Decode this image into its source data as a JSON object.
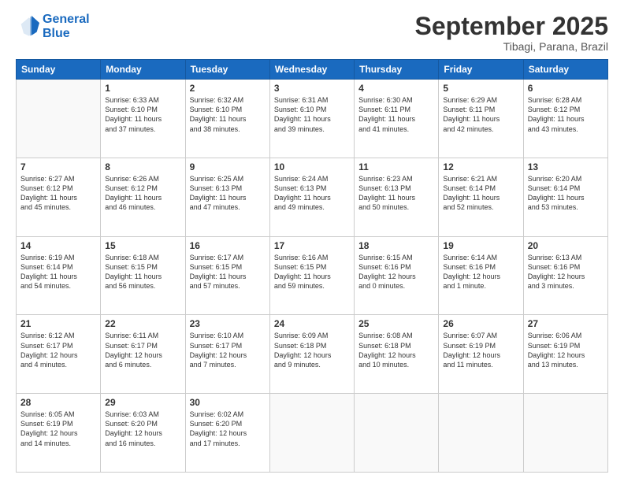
{
  "logo": {
    "line1": "General",
    "line2": "Blue"
  },
  "title": "September 2025",
  "location": "Tibagi, Parana, Brazil",
  "days_of_week": [
    "Sunday",
    "Monday",
    "Tuesday",
    "Wednesday",
    "Thursday",
    "Friday",
    "Saturday"
  ],
  "weeks": [
    [
      {
        "day": "",
        "content": ""
      },
      {
        "day": "1",
        "content": "Sunrise: 6:33 AM\nSunset: 6:10 PM\nDaylight: 11 hours\nand 37 minutes."
      },
      {
        "day": "2",
        "content": "Sunrise: 6:32 AM\nSunset: 6:10 PM\nDaylight: 11 hours\nand 38 minutes."
      },
      {
        "day": "3",
        "content": "Sunrise: 6:31 AM\nSunset: 6:10 PM\nDaylight: 11 hours\nand 39 minutes."
      },
      {
        "day": "4",
        "content": "Sunrise: 6:30 AM\nSunset: 6:11 PM\nDaylight: 11 hours\nand 41 minutes."
      },
      {
        "day": "5",
        "content": "Sunrise: 6:29 AM\nSunset: 6:11 PM\nDaylight: 11 hours\nand 42 minutes."
      },
      {
        "day": "6",
        "content": "Sunrise: 6:28 AM\nSunset: 6:12 PM\nDaylight: 11 hours\nand 43 minutes."
      }
    ],
    [
      {
        "day": "7",
        "content": "Sunrise: 6:27 AM\nSunset: 6:12 PM\nDaylight: 11 hours\nand 45 minutes."
      },
      {
        "day": "8",
        "content": "Sunrise: 6:26 AM\nSunset: 6:12 PM\nDaylight: 11 hours\nand 46 minutes."
      },
      {
        "day": "9",
        "content": "Sunrise: 6:25 AM\nSunset: 6:13 PM\nDaylight: 11 hours\nand 47 minutes."
      },
      {
        "day": "10",
        "content": "Sunrise: 6:24 AM\nSunset: 6:13 PM\nDaylight: 11 hours\nand 49 minutes."
      },
      {
        "day": "11",
        "content": "Sunrise: 6:23 AM\nSunset: 6:13 PM\nDaylight: 11 hours\nand 50 minutes."
      },
      {
        "day": "12",
        "content": "Sunrise: 6:21 AM\nSunset: 6:14 PM\nDaylight: 11 hours\nand 52 minutes."
      },
      {
        "day": "13",
        "content": "Sunrise: 6:20 AM\nSunset: 6:14 PM\nDaylight: 11 hours\nand 53 minutes."
      }
    ],
    [
      {
        "day": "14",
        "content": "Sunrise: 6:19 AM\nSunset: 6:14 PM\nDaylight: 11 hours\nand 54 minutes."
      },
      {
        "day": "15",
        "content": "Sunrise: 6:18 AM\nSunset: 6:15 PM\nDaylight: 11 hours\nand 56 minutes."
      },
      {
        "day": "16",
        "content": "Sunrise: 6:17 AM\nSunset: 6:15 PM\nDaylight: 11 hours\nand 57 minutes."
      },
      {
        "day": "17",
        "content": "Sunrise: 6:16 AM\nSunset: 6:15 PM\nDaylight: 11 hours\nand 59 minutes."
      },
      {
        "day": "18",
        "content": "Sunrise: 6:15 AM\nSunset: 6:16 PM\nDaylight: 12 hours\nand 0 minutes."
      },
      {
        "day": "19",
        "content": "Sunrise: 6:14 AM\nSunset: 6:16 PM\nDaylight: 12 hours\nand 1 minute."
      },
      {
        "day": "20",
        "content": "Sunrise: 6:13 AM\nSunset: 6:16 PM\nDaylight: 12 hours\nand 3 minutes."
      }
    ],
    [
      {
        "day": "21",
        "content": "Sunrise: 6:12 AM\nSunset: 6:17 PM\nDaylight: 12 hours\nand 4 minutes."
      },
      {
        "day": "22",
        "content": "Sunrise: 6:11 AM\nSunset: 6:17 PM\nDaylight: 12 hours\nand 6 minutes."
      },
      {
        "day": "23",
        "content": "Sunrise: 6:10 AM\nSunset: 6:17 PM\nDaylight: 12 hours\nand 7 minutes."
      },
      {
        "day": "24",
        "content": "Sunrise: 6:09 AM\nSunset: 6:18 PM\nDaylight: 12 hours\nand 9 minutes."
      },
      {
        "day": "25",
        "content": "Sunrise: 6:08 AM\nSunset: 6:18 PM\nDaylight: 12 hours\nand 10 minutes."
      },
      {
        "day": "26",
        "content": "Sunrise: 6:07 AM\nSunset: 6:19 PM\nDaylight: 12 hours\nand 11 minutes."
      },
      {
        "day": "27",
        "content": "Sunrise: 6:06 AM\nSunset: 6:19 PM\nDaylight: 12 hours\nand 13 minutes."
      }
    ],
    [
      {
        "day": "28",
        "content": "Sunrise: 6:05 AM\nSunset: 6:19 PM\nDaylight: 12 hours\nand 14 minutes."
      },
      {
        "day": "29",
        "content": "Sunrise: 6:03 AM\nSunset: 6:20 PM\nDaylight: 12 hours\nand 16 minutes."
      },
      {
        "day": "30",
        "content": "Sunrise: 6:02 AM\nSunset: 6:20 PM\nDaylight: 12 hours\nand 17 minutes."
      },
      {
        "day": "",
        "content": ""
      },
      {
        "day": "",
        "content": ""
      },
      {
        "day": "",
        "content": ""
      },
      {
        "day": "",
        "content": ""
      }
    ]
  ]
}
